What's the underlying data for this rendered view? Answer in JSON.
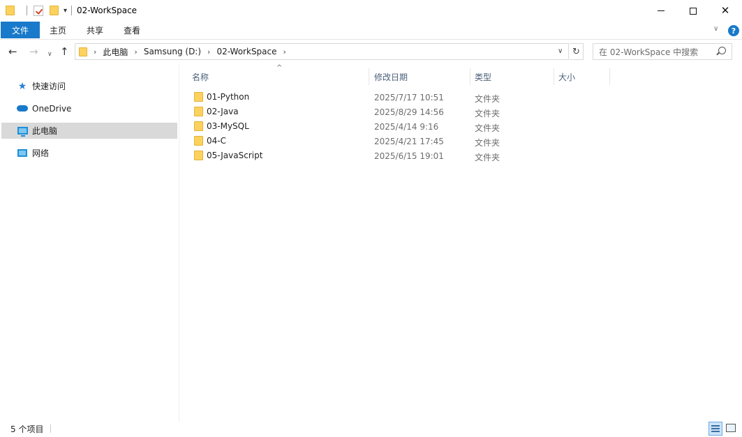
{
  "window": {
    "title": "02-WorkSpace",
    "qat_dropdown": "▾",
    "minimize": "—",
    "maximize": "☐",
    "close": "✕"
  },
  "ribbon": {
    "tabs": [
      {
        "label": "文件"
      },
      {
        "label": "主页"
      },
      {
        "label": "共享"
      },
      {
        "label": "查看"
      }
    ],
    "expand": "∨",
    "help": "?"
  },
  "nav": {
    "back": "←",
    "forward": "→",
    "recent": "∨",
    "up": "↑",
    "breadcrumbs": [
      "此电脑",
      "Samsung (D:)",
      "02-WorkSpace"
    ],
    "crumb_sep": "›",
    "dropdown": "∨",
    "refresh": "↻",
    "search_placeholder": "在 02-WorkSpace 中搜索"
  },
  "sidebar": {
    "items": [
      {
        "label": "快速访问",
        "icon": "star-icon"
      },
      {
        "label": "OneDrive",
        "icon": "cloud-icon"
      },
      {
        "label": "此电脑",
        "icon": "computer-icon",
        "selected": true
      },
      {
        "label": "网络",
        "icon": "network-icon"
      }
    ]
  },
  "list": {
    "sort_indicator": "^",
    "columns": {
      "name": "名称",
      "date": "修改日期",
      "type": "类型",
      "size": "大小"
    },
    "rows": [
      {
        "name": "01-Python",
        "date": "2025/7/17 10:51",
        "type": "文件夹"
      },
      {
        "name": "02-Java",
        "date": "2025/8/29 14:56",
        "type": "文件夹"
      },
      {
        "name": "03-MySQL",
        "date": "2025/4/14 9:16",
        "type": "文件夹"
      },
      {
        "name": "04-C",
        "date": "2025/4/21 17:45",
        "type": "文件夹"
      },
      {
        "name": "05-JavaScript",
        "date": "2025/6/15 19:01",
        "type": "文件夹"
      }
    ]
  },
  "status": {
    "count": "5 个项目"
  },
  "colors": {
    "accent": "#1979ca",
    "folder": "#fcd25e",
    "selected_bg": "#d9d9d9"
  }
}
